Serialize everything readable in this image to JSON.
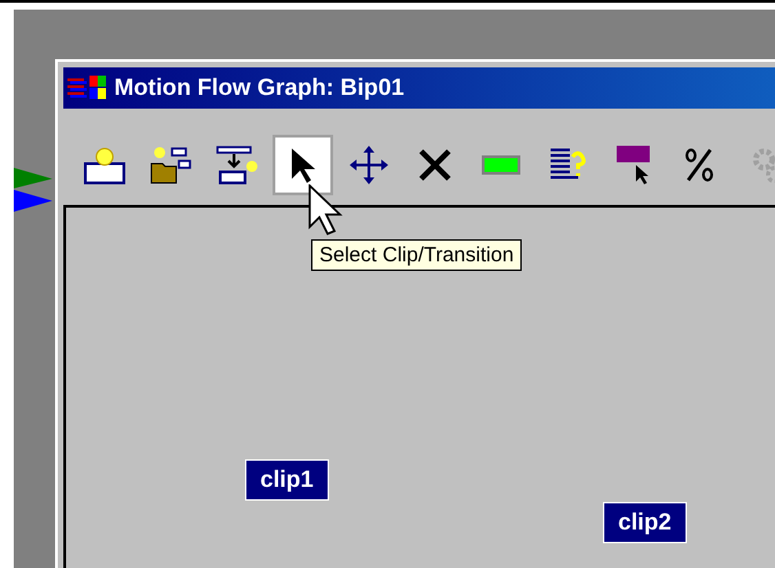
{
  "window": {
    "title": "Motion Flow Graph: Bip01"
  },
  "toolbar": [
    {
      "kind": "new",
      "selected": false
    },
    {
      "kind": "open",
      "selected": false
    },
    {
      "kind": "insert",
      "selected": false
    },
    {
      "kind": "select",
      "selected": true
    },
    {
      "kind": "move",
      "selected": false
    },
    {
      "kind": "delete",
      "selected": false
    },
    {
      "kind": "green",
      "selected": false
    },
    {
      "kind": "list",
      "selected": false
    },
    {
      "kind": "purple",
      "selected": false
    },
    {
      "kind": "percent",
      "selected": false
    },
    {
      "kind": "gears",
      "selected": false
    }
  ],
  "tooltip": "Select Clip/Transition",
  "clips": [
    {
      "label": "clip1"
    },
    {
      "label": "clip2"
    }
  ]
}
